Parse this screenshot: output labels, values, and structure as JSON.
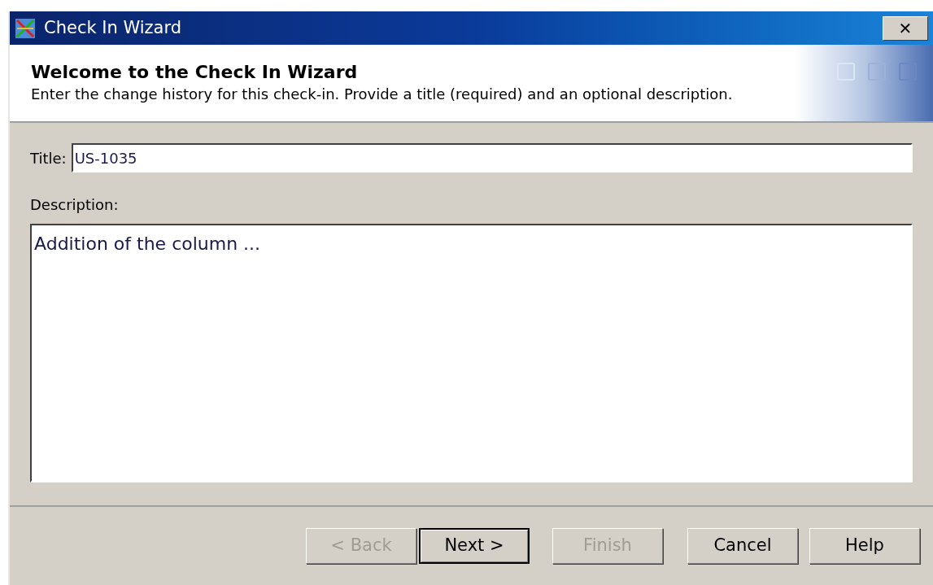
{
  "window": {
    "title": "Check In Wizard",
    "close": "✕"
  },
  "header": {
    "heading": "Welcome to the Check In Wizard",
    "subtitle": "Enter the change history for this check-in.  Provide a title (required) and an optional description."
  },
  "form": {
    "title_label": "Title:",
    "title_value": "US-1035",
    "description_label": "Description:",
    "description_value": "Addition of the column ..."
  },
  "buttons": [
    {
      "label": "< Back",
      "disabled": true,
      "default": false
    },
    {
      "label": "Next >",
      "disabled": false,
      "default": true
    },
    {
      "label": "Finish",
      "disabled": true,
      "default": false
    },
    {
      "label": "Cancel",
      "disabled": false,
      "default": false
    },
    {
      "label": "Help",
      "disabled": false,
      "default": false
    }
  ]
}
